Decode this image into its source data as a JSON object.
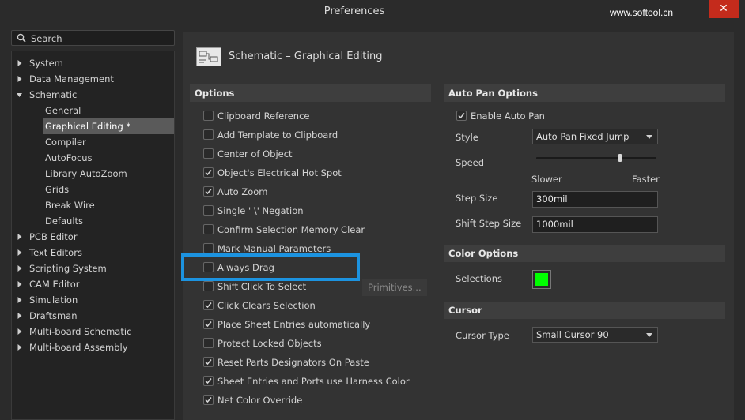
{
  "window": {
    "title": "Preferences",
    "watermark": "www.softool.cn",
    "close_glyph": "✕"
  },
  "search": {
    "placeholder": "Search"
  },
  "tree": [
    {
      "label": "System",
      "level": 0,
      "expanded": false
    },
    {
      "label": "Data Management",
      "level": 0,
      "expanded": false
    },
    {
      "label": "Schematic",
      "level": 0,
      "expanded": true
    },
    {
      "label": "General",
      "level": 1
    },
    {
      "label": "Graphical Editing *",
      "level": 1,
      "selected": true
    },
    {
      "label": "Compiler",
      "level": 1
    },
    {
      "label": "AutoFocus",
      "level": 1
    },
    {
      "label": "Library AutoZoom",
      "level": 1
    },
    {
      "label": "Grids",
      "level": 1
    },
    {
      "label": "Break Wire",
      "level": 1
    },
    {
      "label": "Defaults",
      "level": 1
    },
    {
      "label": "PCB Editor",
      "level": 0,
      "expanded": false
    },
    {
      "label": "Text Editors",
      "level": 0,
      "expanded": false
    },
    {
      "label": "Scripting System",
      "level": 0,
      "expanded": false
    },
    {
      "label": "CAM Editor",
      "level": 0,
      "expanded": false
    },
    {
      "label": "Simulation",
      "level": 0,
      "expanded": false
    },
    {
      "label": "Draftsman",
      "level": 0,
      "expanded": false
    },
    {
      "label": "Multi-board Schematic",
      "level": 0,
      "expanded": false
    },
    {
      "label": "Multi-board Assembly",
      "level": 0,
      "expanded": false
    }
  ],
  "page": {
    "title": "Schematic – Graphical Editing",
    "icon": "schematic-page-icon"
  },
  "options": {
    "header": "Options",
    "items": [
      {
        "label": "Clipboard Reference",
        "checked": false
      },
      {
        "label": "Add Template to Clipboard",
        "checked": false
      },
      {
        "label": "Center of Object",
        "checked": false
      },
      {
        "label": "Object's Electrical Hot Spot",
        "checked": true
      },
      {
        "label": "Auto Zoom",
        "checked": true
      },
      {
        "label": "Single ' \\' Negation",
        "checked": false
      },
      {
        "label": "Confirm Selection Memory Clear",
        "checked": false
      },
      {
        "label": "Mark Manual Parameters",
        "checked": false
      },
      {
        "label": "Always Drag",
        "checked": false,
        "highlighted": true
      },
      {
        "label": "Shift Click To Select",
        "checked": false
      },
      {
        "label": "Click Clears Selection",
        "checked": true
      },
      {
        "label": "Place Sheet Entries automatically",
        "checked": true
      },
      {
        "label": "Protect Locked Objects",
        "checked": false
      },
      {
        "label": "Reset Parts Designators On Paste",
        "checked": true
      },
      {
        "label": "Sheet Entries and Ports use Harness Color",
        "checked": true
      },
      {
        "label": "Net Color Override",
        "checked": true
      }
    ],
    "primitives_button": "Primitives..."
  },
  "auto_pan": {
    "header": "Auto Pan Options",
    "enable_label": "Enable Auto Pan",
    "enable_checked": true,
    "style_label": "Style",
    "style_value": "Auto Pan Fixed Jump",
    "speed_label": "Speed",
    "speed_level": 0.7,
    "slower_label": "Slower",
    "faster_label": "Faster",
    "step_size_label": "Step Size",
    "step_size_value": "300mil",
    "shift_step_label": "Shift Step Size",
    "shift_step_value": "1000mil"
  },
  "color_options": {
    "header": "Color Options",
    "selections_label": "Selections",
    "selections_color": "#00ff00"
  },
  "cursor": {
    "header": "Cursor",
    "type_label": "Cursor Type",
    "type_value": "Small Cursor 90"
  },
  "colors": {
    "highlight": "#1c93e0",
    "close": "#c42b1c",
    "selected_item": "#5a5a5a"
  }
}
